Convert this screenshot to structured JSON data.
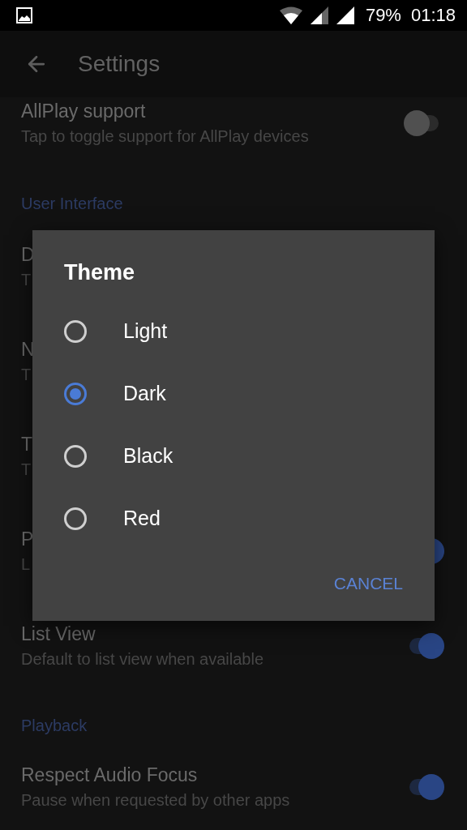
{
  "status_bar": {
    "battery": "79%",
    "time": "01:18"
  },
  "toolbar": {
    "title": "Settings"
  },
  "settings": [
    {
      "kind": "switch_row",
      "title": "AllPlay support",
      "subtitle": "Tap to toggle support for AllPlay devices",
      "on": false
    },
    {
      "kind": "header",
      "label": "User Interface"
    },
    {
      "kind": "row",
      "title": "D",
      "subtitle": "T"
    },
    {
      "kind": "row",
      "title": "N",
      "subtitle": "T"
    },
    {
      "kind": "row",
      "title": "T",
      "subtitle": "T"
    },
    {
      "kind": "switch_row",
      "title": "P",
      "subtitle": "L",
      "on": true
    },
    {
      "kind": "switch_row",
      "title": "List View",
      "subtitle": "Default to list view when available",
      "on": true
    },
    {
      "kind": "header",
      "label": "Playback"
    },
    {
      "kind": "switch_row",
      "title": "Respect Audio Focus",
      "subtitle": "Pause when requested by other apps",
      "on": true
    }
  ],
  "dialog": {
    "title": "Theme",
    "options": [
      {
        "label": "Light",
        "selected": false
      },
      {
        "label": "Dark",
        "selected": true
      },
      {
        "label": "Black",
        "selected": false
      },
      {
        "label": "Red",
        "selected": false
      }
    ],
    "buttons": [
      "CANCEL"
    ]
  }
}
